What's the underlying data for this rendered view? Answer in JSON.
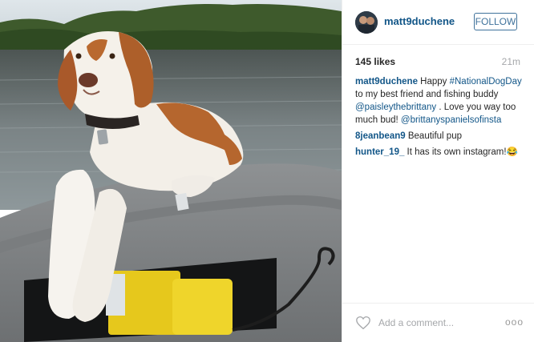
{
  "post": {
    "username": "matt9duchene",
    "follow_label": "FOLLOW",
    "likes": "145 likes",
    "time": "21m",
    "caption": {
      "user": "matt9duchene",
      "t1": " Happy ",
      "hashtag": "#NationalDogDay",
      "t2": " to my best friend and fishing buddy ",
      "mention1": "@paisleythebrittany",
      "t3": " . Love you way too much bud! ",
      "mention2": "@brittanyspanielsofinsta"
    },
    "comments": [
      {
        "user": "8jeanbean9",
        "text": " Beautiful pup"
      },
      {
        "user": "hunter_19_",
        "text": " It has its own instagram!😂"
      }
    ],
    "add_comment_placeholder": "Add a comment...",
    "more_label": "ooo"
  },
  "colors": {
    "link": "#125688",
    "follow": "#3f729b",
    "muted": "#a5a7aa"
  },
  "icons": {
    "like": "heart-outline-icon",
    "more": "ellipsis-icon"
  }
}
